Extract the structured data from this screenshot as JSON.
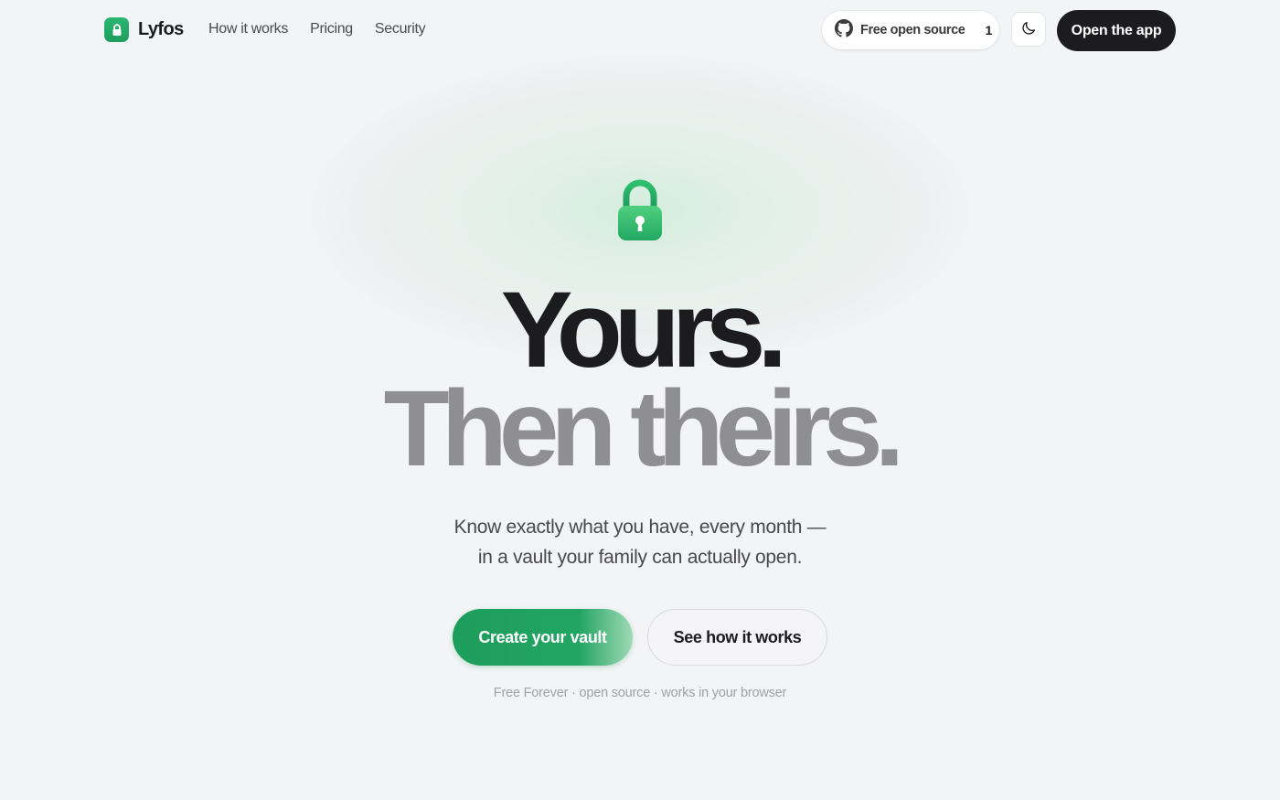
{
  "header": {
    "brand": "Lyfos",
    "nav_links": [
      "How it works",
      "Pricing",
      "Security"
    ],
    "github": {
      "label": "Free open source",
      "count": "1"
    },
    "open_app_label": "Open the app"
  },
  "hero": {
    "headline_line1": "Yours.",
    "headline_line2": "Then theirs.",
    "subtitle_line1": "Know exactly what you have, every month —",
    "subtitle_line2": "in a vault your family can actually open.",
    "primary_cta": "Create your vault",
    "secondary_cta": "See how it works",
    "fineprint": "Free Forever · open source · works in your browser"
  },
  "icons": {
    "brand": "lock-icon",
    "github": "github-icon",
    "theme_toggle": "moon-icon",
    "hero": "padlock-icon"
  },
  "colors": {
    "accent_green": "#1e9d5c",
    "dark": "#1c1c1e",
    "muted_headline": "#8e8e93",
    "background": "#f3f4f6"
  }
}
